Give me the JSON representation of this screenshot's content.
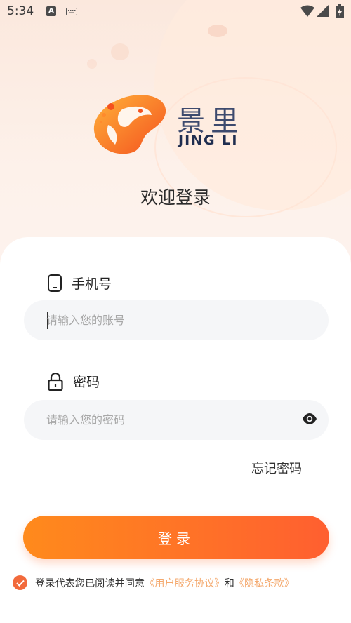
{
  "status_bar": {
    "time": "5:34",
    "a_badge": "A"
  },
  "logo": {
    "name_cn": "景里",
    "name_en": "JING LI"
  },
  "welcome": "欢迎登录",
  "phone": {
    "label": "手机号",
    "placeholder": "请输入您的账号"
  },
  "password": {
    "label": "密码",
    "placeholder": "请输入您的密码"
  },
  "forgot": "忘记密码",
  "login_button": "登录",
  "agreement": {
    "prefix": "登录代表您已阅读并同意",
    "user_agreement": "《用户服务协议》",
    "and": "和",
    "privacy": "《隐私条款》",
    "checked": true
  },
  "colors": {
    "accent": "#FF6A2C",
    "link": "#F4A96E",
    "brand_navy": "#3D4A6E"
  }
}
